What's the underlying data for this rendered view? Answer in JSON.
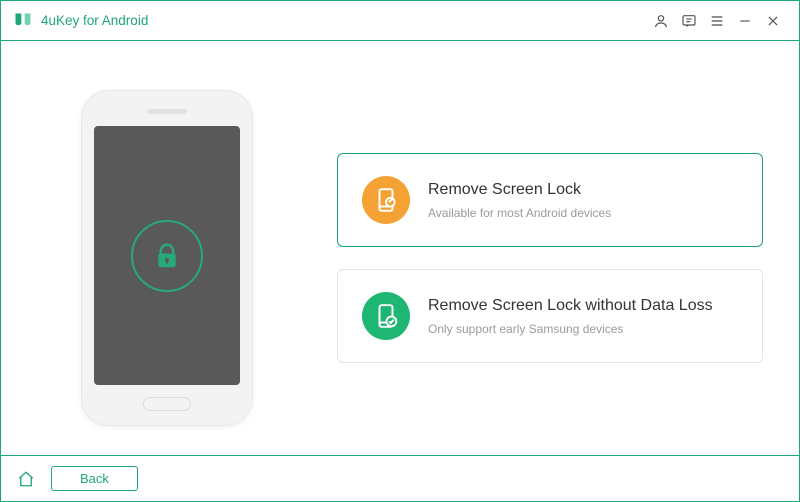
{
  "title": "4uKey for Android",
  "options": [
    {
      "title": "Remove Screen Lock",
      "subtitle": "Available for most Android devices",
      "selected": true,
      "icon_color": "orange"
    },
    {
      "title": "Remove Screen Lock without Data Loss",
      "subtitle": "Only support early Samsung devices",
      "selected": false,
      "icon_color": "green"
    }
  ],
  "footer": {
    "back_label": "Back"
  }
}
